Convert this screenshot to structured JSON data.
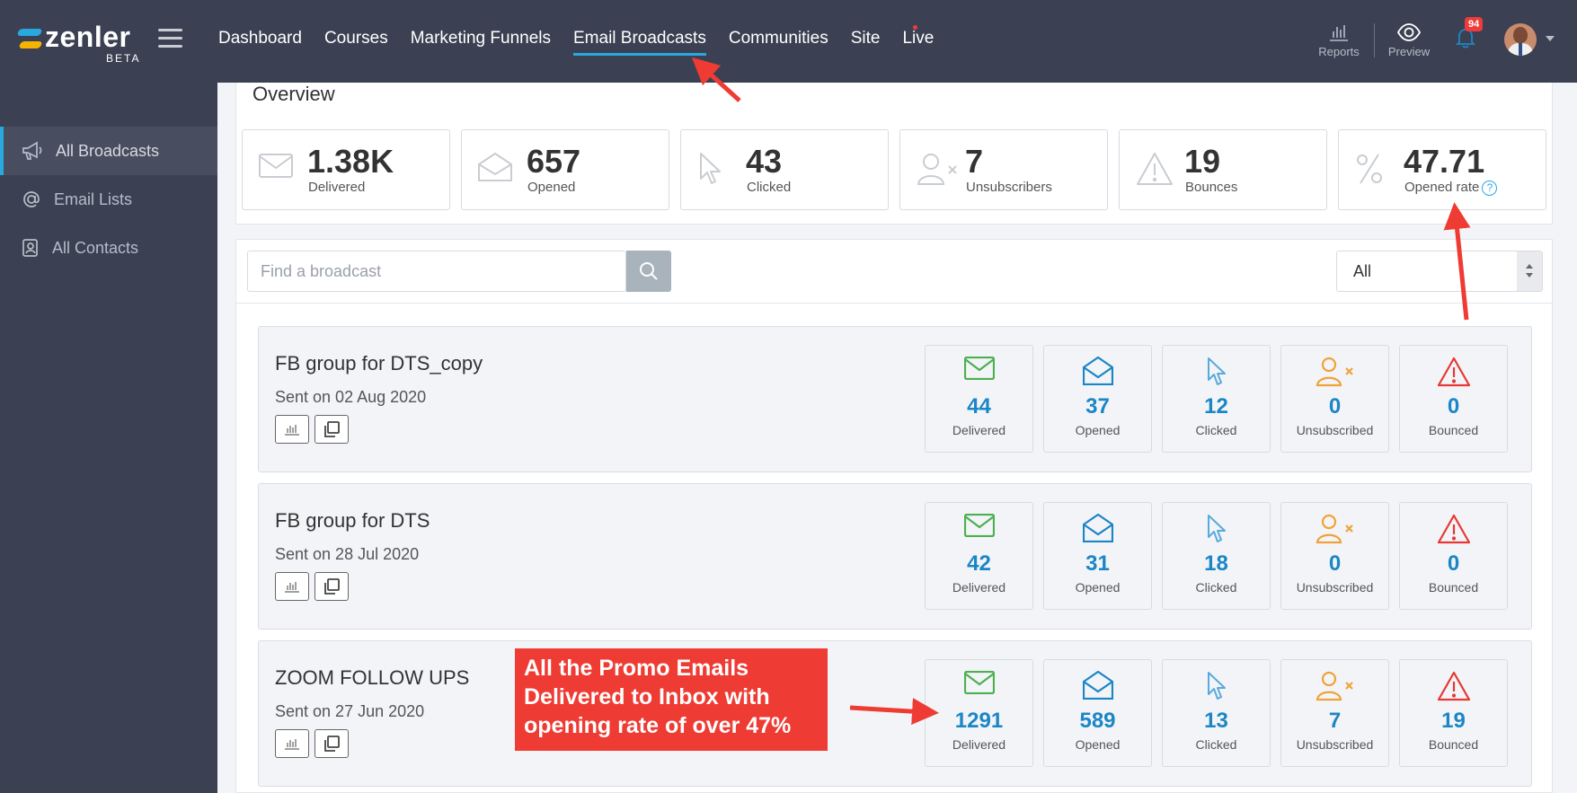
{
  "brand": {
    "name": "zenler",
    "tag": "BETA"
  },
  "nav": [
    {
      "label": "Dashboard"
    },
    {
      "label": "Courses"
    },
    {
      "label": "Marketing Funnels"
    },
    {
      "label": "Email Broadcasts",
      "active": true
    },
    {
      "label": "Communities"
    },
    {
      "label": "Site"
    },
    {
      "label": "Live"
    }
  ],
  "topbar": {
    "reports_label": "Reports",
    "preview_label": "Preview",
    "notifications_count": "94"
  },
  "sidebar": {
    "items": [
      {
        "label": "All Broadcasts",
        "icon": "megaphone-icon",
        "active": true
      },
      {
        "label": "Email Lists",
        "icon": "at-icon"
      },
      {
        "label": "All Contacts",
        "icon": "contacts-icon"
      }
    ]
  },
  "overview": {
    "title": "Overview",
    "stats": [
      {
        "value": "1.38K",
        "label": "Delivered",
        "icon": "envelope-icon"
      },
      {
        "value": "657",
        "label": "Opened",
        "icon": "open-envelope-icon"
      },
      {
        "value": "43",
        "label": "Clicked",
        "icon": "cursor-icon"
      },
      {
        "value": "7",
        "label": "Unsubscribers",
        "icon": "user-x-icon"
      },
      {
        "value": "19",
        "label": "Bounces",
        "icon": "warning-icon"
      },
      {
        "value": "47.71",
        "label": "Opened rate",
        "icon": "percent-icon",
        "help": "?"
      }
    ]
  },
  "search": {
    "placeholder": "Find a broadcast"
  },
  "filter": {
    "selected": "All"
  },
  "broadcasts": [
    {
      "name": "FB group for DTS_copy",
      "date": "Sent on 02 Aug 2020",
      "stats": {
        "delivered": "44",
        "opened": "37",
        "clicked": "12",
        "unsubscribed": "0",
        "bounced": "0"
      }
    },
    {
      "name": "FB group for DTS",
      "date": "Sent on 28 Jul 2020",
      "stats": {
        "delivered": "42",
        "opened": "31",
        "clicked": "18",
        "unsubscribed": "0",
        "bounced": "0"
      }
    },
    {
      "name": "ZOOM FOLLOW UPS",
      "date": "Sent on 27 Jun 2020",
      "stats": {
        "delivered": "1291",
        "opened": "589",
        "clicked": "13",
        "unsubscribed": "7",
        "bounced": "19"
      }
    }
  ],
  "stat_labels": {
    "delivered": "Delivered",
    "opened": "Opened",
    "clicked": "Clicked",
    "unsubscribed": "Unsubscribed",
    "bounced": "Bounced"
  },
  "annotation": {
    "line1": "All the Promo Emails",
    "line2": "Delivered to Inbox with",
    "line3": "opening rate of over 47%"
  },
  "colors": {
    "topbar": "#3b4152",
    "accent": "#29a8e0",
    "delivered": "#4cb050",
    "opened": "#1b86c6",
    "clicked": "#5aa9dc",
    "unsubscribed": "#f0a23a",
    "bounced": "#e53935",
    "annotation": "#ee3b33"
  }
}
